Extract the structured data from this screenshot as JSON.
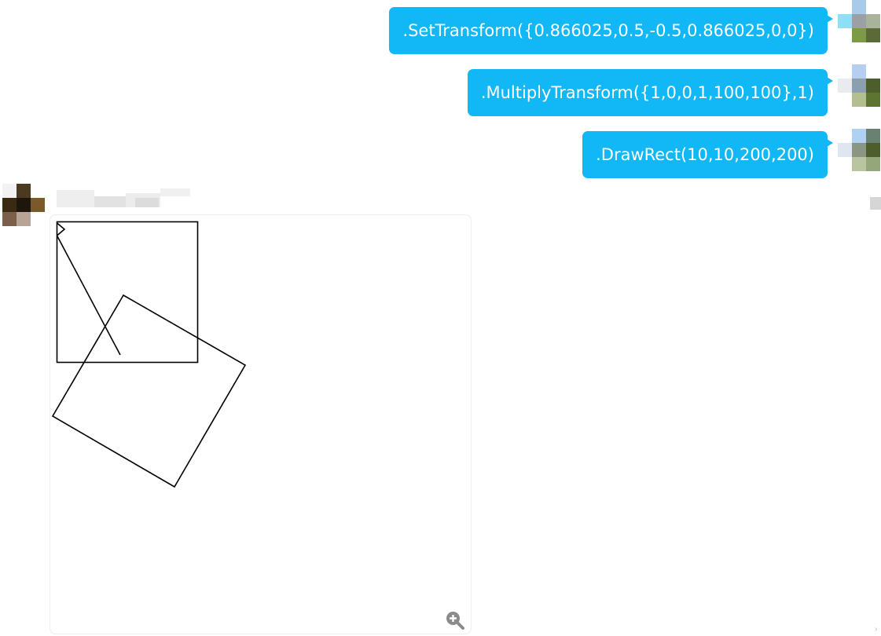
{
  "messages": [
    {
      "sender": "self",
      "text": ".SetTransform({0.866025,0.5,-0.5,0.866025,0,0})"
    },
    {
      "sender": "self",
      "text": ".MultiplyTransform({1,0,0,1,100,100},1)"
    },
    {
      "sender": "self",
      "text": ".DrawRect(10,10,200,200)"
    }
  ],
  "reply": {
    "sender": "other",
    "attachment": "image",
    "zoom_icon": "zoom-in-icon"
  },
  "colors": {
    "bubble_self": "#12b7f5",
    "bubble_text": "#ffffff",
    "drawing_stroke": "#000000",
    "card_border": "#eceef0"
  },
  "corner_glyph": "›"
}
